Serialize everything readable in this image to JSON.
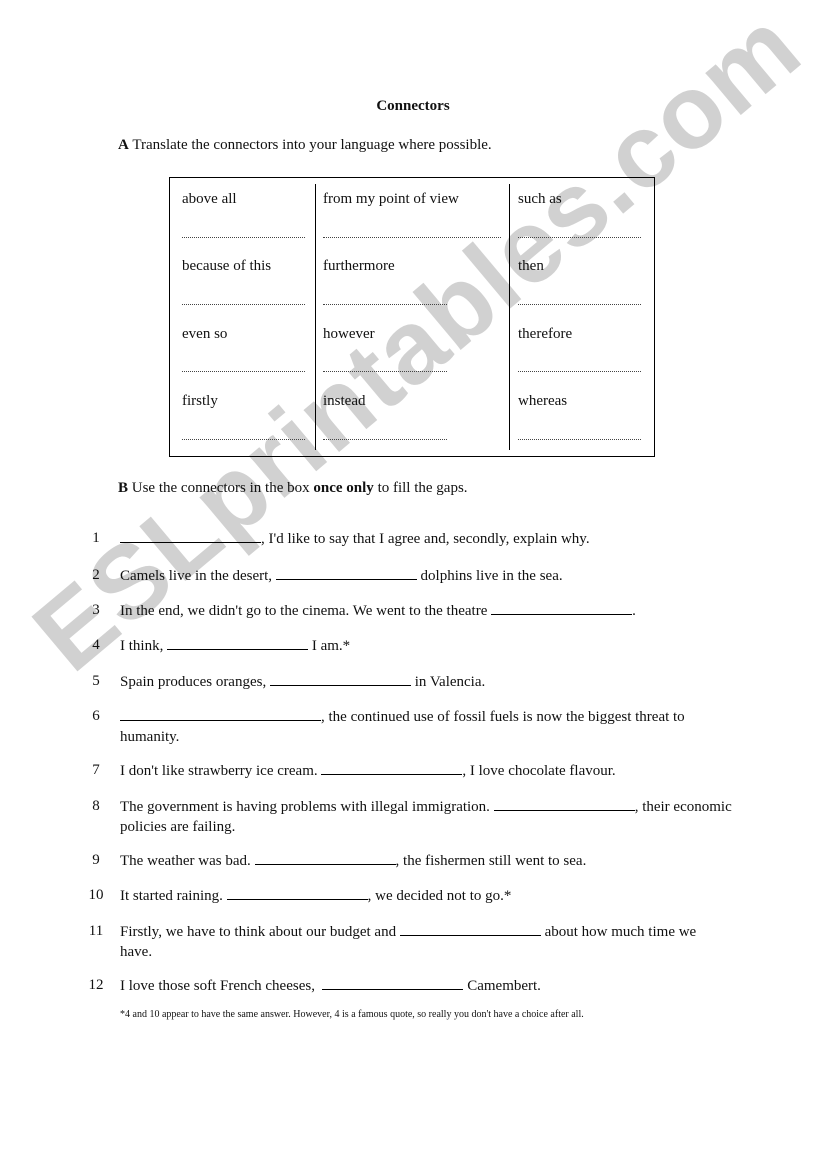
{
  "title": "Connectors",
  "section_a": {
    "letter": "A",
    "instruction": " Translate the connectors into your language where possible."
  },
  "connectors_box": {
    "columns": [
      [
        "above all",
        "because of this",
        "even so",
        "firstly"
      ],
      [
        "from my point of view",
        "furthermore",
        "however",
        "instead"
      ],
      [
        "such as",
        "then",
        "therefore",
        "whereas"
      ]
    ]
  },
  "section_b": {
    "letter": "B",
    "instruction_pre": " Use the connectors in the box ",
    "instruction_bold": "once only",
    "instruction_post": " to fill the gaps."
  },
  "questions": [
    {
      "num": "1",
      "before": "",
      "after": ", I'd like to say that I agree and, secondly, explain why."
    },
    {
      "num": "2",
      "before": "Camels live in the desert, ",
      "after": " dolphins live in the sea."
    },
    {
      "num": "3",
      "before": "In the end, we didn't go to the cinema. We went to the theatre ",
      "after": "."
    },
    {
      "num": "4",
      "before": "I think, ",
      "after": " I am.*"
    },
    {
      "num": "5",
      "before": "Spain produces oranges, ",
      "after": " in Valencia."
    },
    {
      "num": "6",
      "before": "",
      "after": ", the continued use of fossil fuels is now the biggest threat to humanity."
    },
    {
      "num": "7",
      "before": "I don't like strawberry ice cream. ",
      "after": ", I love chocolate flavour."
    },
    {
      "num": "8",
      "before": "The government is having problems with illegal immigration. ",
      "after": ", their economic policies are failing."
    },
    {
      "num": "9",
      "before": "The weather was bad. ",
      "after": ", the fishermen still went to sea."
    },
    {
      "num": "10",
      "before": "It started raining. ",
      "after": ", we decided not to go.*"
    },
    {
      "num": "11",
      "before": "Firstly, we have to think about our budget and ",
      "after": " about how much time we have."
    },
    {
      "num": "12",
      "before": "I love those soft French cheeses,  ",
      "after": " Camembert."
    }
  ],
  "footnote": "*4 and 10 appear to have the same answer. However, 4 is a famous quote, so really you don't have a choice after all.",
  "watermark": "ESLprintables.com",
  "colors": {
    "text": "#111111",
    "watermark": "#c9c9c9",
    "border": "#000000"
  }
}
